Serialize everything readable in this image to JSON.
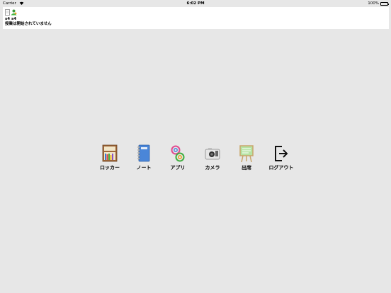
{
  "status_bar": {
    "carrier": "Carrier",
    "time": "6:02 PM",
    "battery": "100%"
  },
  "header": {
    "user": "s4 s4",
    "status": "授業は開始されていません"
  },
  "dock": {
    "items": [
      {
        "label": "ロッカー",
        "icon": "locker-icon"
      },
      {
        "label": "ノート",
        "icon": "notebook-icon"
      },
      {
        "label": "アプリ",
        "icon": "apps-icon"
      },
      {
        "label": "カメラ",
        "icon": "camera-icon"
      },
      {
        "label": "出席",
        "icon": "attendance-icon"
      },
      {
        "label": "ログアウト",
        "icon": "logout-icon"
      }
    ]
  }
}
